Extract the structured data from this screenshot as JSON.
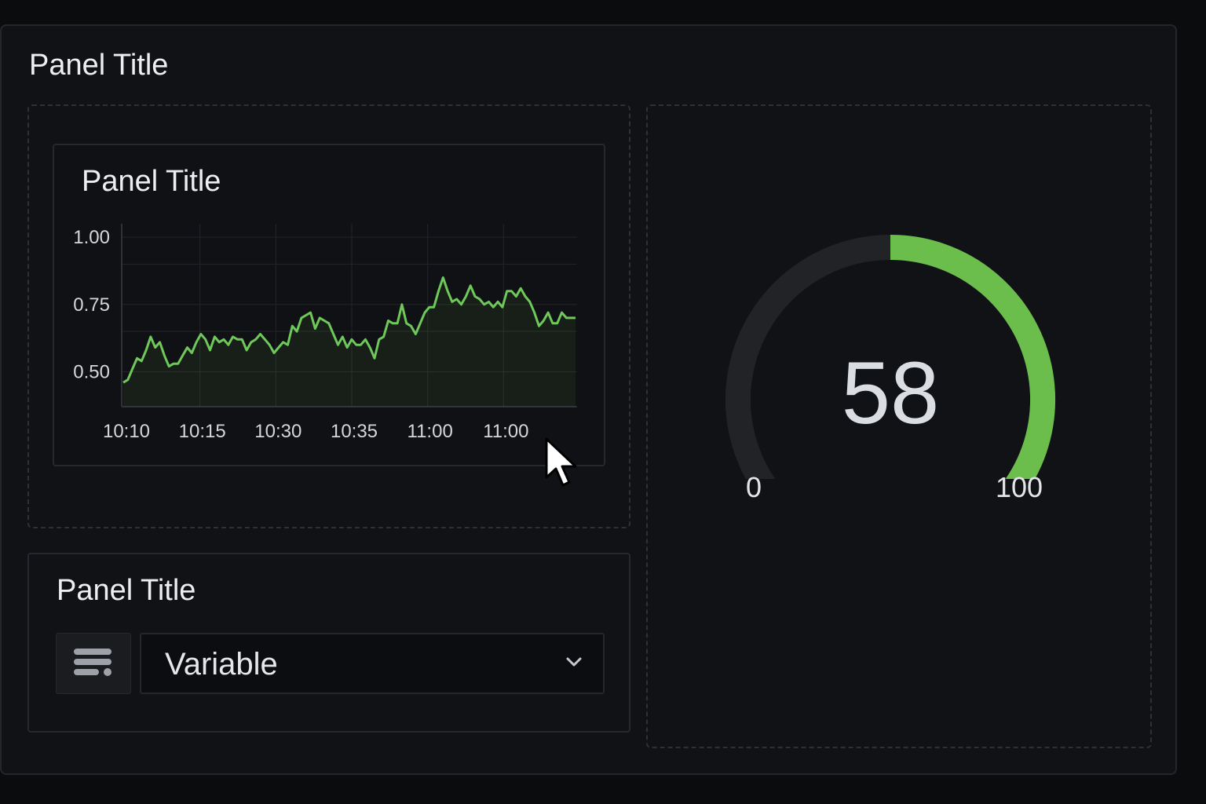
{
  "dashboard": {
    "panel_title": "Panel Title"
  },
  "graph_panel": {
    "title": "Panel Title"
  },
  "chart_data": {
    "type": "line",
    "title": "Panel Title",
    "xlabel": "",
    "ylabel": "",
    "ylim": [
      0.37,
      1.05
    ],
    "y_ticks": [
      "1.00",
      "0.75",
      "0.50"
    ],
    "y_tick_values": [
      1.0,
      0.75,
      0.5
    ],
    "x_ticks": [
      "10:10",
      "10:15",
      "10:30",
      "10:35",
      "11:00",
      "11:00"
    ],
    "grid": true,
    "series": [
      {
        "color": "#6fc85a",
        "fill": "area",
        "values": [
          0.46,
          0.47,
          0.51,
          0.55,
          0.54,
          0.58,
          0.63,
          0.59,
          0.61,
          0.56,
          0.52,
          0.53,
          0.53,
          0.56,
          0.59,
          0.57,
          0.61,
          0.64,
          0.62,
          0.58,
          0.63,
          0.61,
          0.62,
          0.6,
          0.63,
          0.62,
          0.62,
          0.58,
          0.61,
          0.62,
          0.64,
          0.62,
          0.6,
          0.57,
          0.59,
          0.61,
          0.6,
          0.67,
          0.65,
          0.7,
          0.71,
          0.72,
          0.66,
          0.7,
          0.69,
          0.68,
          0.64,
          0.6,
          0.63,
          0.59,
          0.62,
          0.6,
          0.6,
          0.62,
          0.59,
          0.55,
          0.62,
          0.63,
          0.69,
          0.68,
          0.68,
          0.75,
          0.68,
          0.67,
          0.64,
          0.68,
          0.72,
          0.74,
          0.74,
          0.8,
          0.85,
          0.8,
          0.76,
          0.77,
          0.75,
          0.78,
          0.82,
          0.78,
          0.77,
          0.75,
          0.76,
          0.74,
          0.76,
          0.74,
          0.8,
          0.8,
          0.78,
          0.81,
          0.78,
          0.76,
          0.72,
          0.67,
          0.69,
          0.72,
          0.68,
          0.68,
          0.72,
          0.7,
          0.7,
          0.7
        ]
      }
    ]
  },
  "gauge": {
    "value": "58",
    "value_number": 58,
    "min": "0",
    "max": "100",
    "color": "#6bbd4c",
    "track_color": "#222326"
  },
  "variable_panel": {
    "title": "Panel Title",
    "icon": "filter-list-icon",
    "selected": "Variable"
  }
}
